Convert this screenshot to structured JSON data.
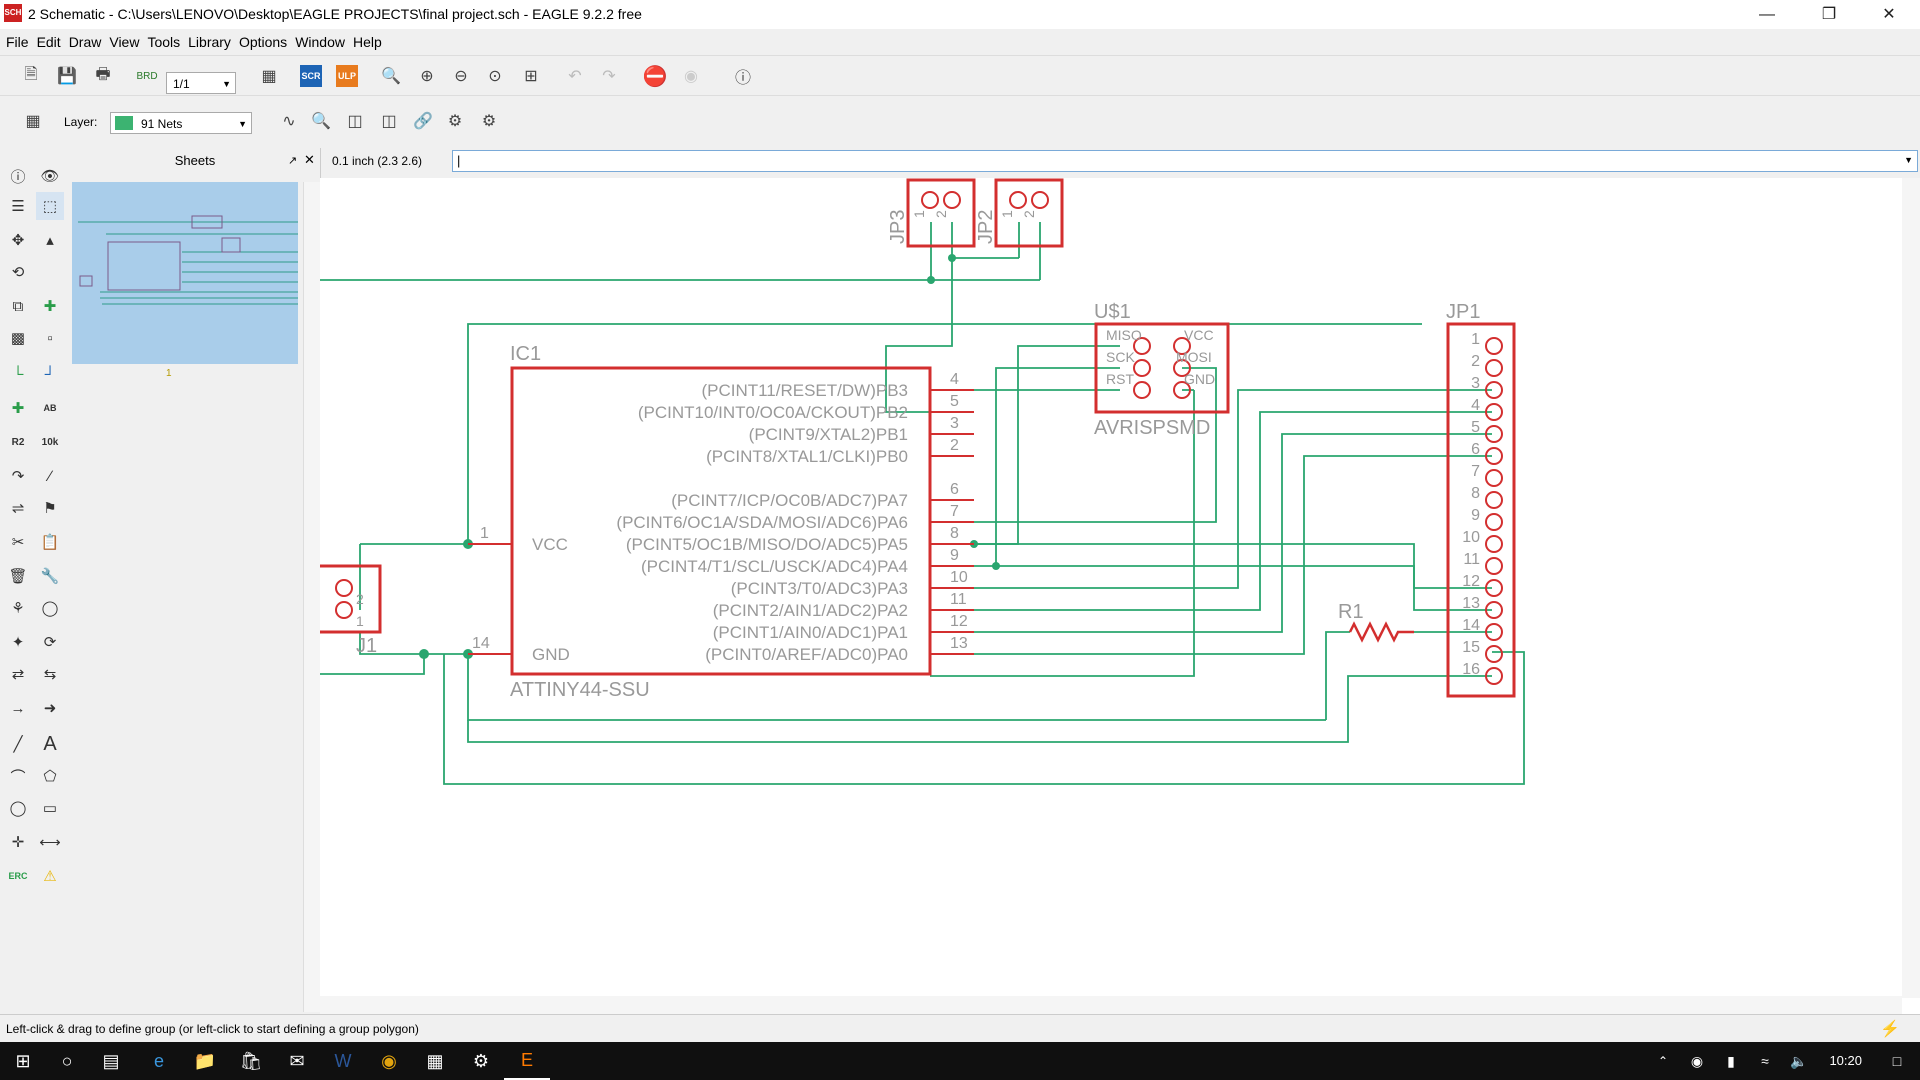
{
  "window": {
    "title": "2 Schematic - C:\\Users\\LENOVO\\Desktop\\EAGLE PROJECTS\\final project.sch - EAGLE 9.2.2 free",
    "app_icon": "SCH",
    "minimize": "—",
    "restore": "❐",
    "close": "✕"
  },
  "menu": [
    "File",
    "Edit",
    "Draw",
    "View",
    "Tools",
    "Library",
    "Options",
    "Window",
    "Help"
  ],
  "toolbar": {
    "sheet_select": "1/1",
    "layer_label": "Layer:",
    "layer_value": "91 Nets",
    "layer_color": "#3cb371",
    "scr": "SCR",
    "ulp": "ULP"
  },
  "sheets_panel": {
    "title": "Sheets",
    "sheet_number": "1"
  },
  "coordinate": "0.1 inch (2.3 2.6)",
  "command_value": "|",
  "schematic": {
    "ic1": {
      "name": "IC1",
      "value": "ATTINY44-SSU",
      "left_pins": [
        {
          "num": "1",
          "label": "VCC"
        },
        {
          "num": "14",
          "label": "GND"
        }
      ],
      "right_pins": [
        {
          "num": "4",
          "label": "(PCINT11/RESET/DW)PB3"
        },
        {
          "num": "5",
          "label": "(PCINT10/INT0/OC0A/CKOUT)PB2"
        },
        {
          "num": "3",
          "label": "(PCINT9/XTAL2)PB1"
        },
        {
          "num": "2",
          "label": "(PCINT8/XTAL1/CLKI)PB0"
        },
        {
          "num": "6",
          "label": "(PCINT7/ICP/OC0B/ADC7)PA7"
        },
        {
          "num": "7",
          "label": "(PCINT6/OC1A/SDA/MOSI/ADC6)PA6"
        },
        {
          "num": "8",
          "label": "(PCINT5/OC1B/MISO/DO/ADC5)PA5"
        },
        {
          "num": "9",
          "label": "(PCINT4/T1/SCL/USCK/ADC4)PA4"
        },
        {
          "num": "10",
          "label": "(PCINT3/T0/ADC3)PA3"
        },
        {
          "num": "11",
          "label": "(PCINT2/AIN1/ADC2)PA2"
        },
        {
          "num": "12",
          "label": "(PCINT1/AIN0/ADC1)PA1"
        },
        {
          "num": "13",
          "label": "(PCINT0/AREF/ADC0)PA0"
        }
      ]
    },
    "u1": {
      "name": "U$1",
      "value": "AVRISPSMD",
      "left_labels": [
        "MISO",
        "SCK",
        "RST"
      ],
      "right_labels": [
        "VCC",
        "MOSI",
        "GND"
      ]
    },
    "jp1": {
      "name": "JP1",
      "pins": [
        "1",
        "2",
        "3",
        "4",
        "5",
        "6",
        "7",
        "8",
        "9",
        "10",
        "11",
        "12",
        "13",
        "14",
        "15",
        "16"
      ]
    },
    "jp2": {
      "name": "JP2",
      "pins": [
        "1",
        "2"
      ]
    },
    "jp3": {
      "name": "JP3",
      "pins": [
        "1",
        "2"
      ]
    },
    "j1": {
      "name": "J1",
      "pins": [
        "2",
        "1"
      ]
    },
    "r1": {
      "name": "R1"
    }
  },
  "status_message": "Left-click & drag to define group (or left-click to start defining a group polygon)",
  "taskbar": {
    "time": "10:20"
  }
}
